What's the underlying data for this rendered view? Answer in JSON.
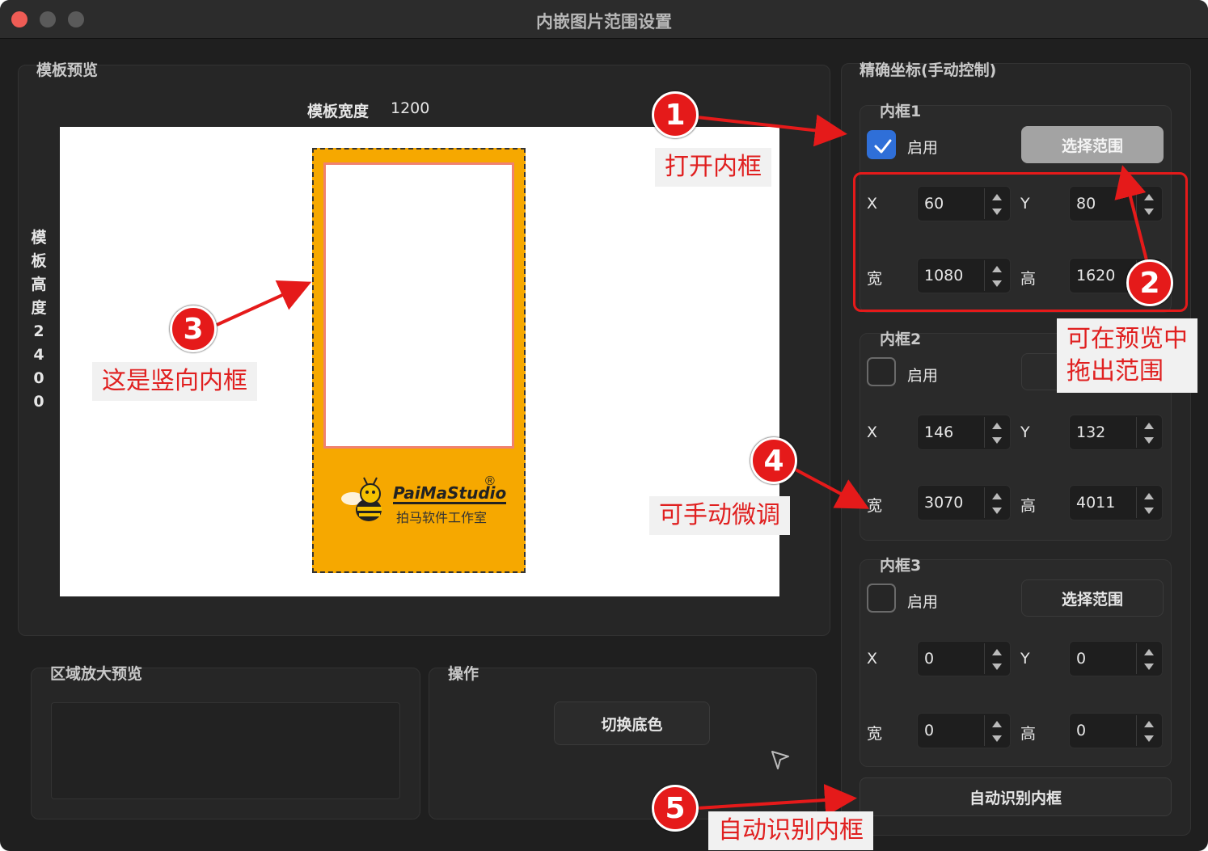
{
  "window": {
    "title": "内嵌图片范围设置"
  },
  "template_preview": {
    "title": "模板预览",
    "width_label": "模板宽度",
    "width_value": "1200",
    "height_label_chars": [
      "模",
      "板",
      "高",
      "度",
      "2",
      "4",
      "0",
      "0"
    ]
  },
  "brand": {
    "name": "PaiMaStudio",
    "registered": "®",
    "subtitle": "拍马软件工作室"
  },
  "zoom_preview": {
    "title": "区域放大预览"
  },
  "operations": {
    "title": "操作",
    "switch_bg_label": "切换底色"
  },
  "precise": {
    "title": "精确坐标(手动控制)",
    "frames": [
      {
        "title": "内框1",
        "enable_label": "启用",
        "enabled": true,
        "select_label": "选择范围",
        "x_label": "X",
        "x": "60",
        "y_label": "Y",
        "y": "80",
        "w_label": "宽",
        "w": "1080",
        "h_label": "高",
        "h": "1620"
      },
      {
        "title": "内框2",
        "enable_label": "启用",
        "enabled": false,
        "x_label": "X",
        "x": "146",
        "y_label": "Y",
        "y": "132",
        "w_label": "宽",
        "w": "3070",
        "h_label": "高",
        "h": "4011"
      },
      {
        "title": "内框3",
        "enable_label": "启用",
        "enabled": false,
        "select_label": "选择范围",
        "x_label": "X",
        "x": "0",
        "y_label": "Y",
        "y": "0",
        "w_label": "宽",
        "w": "0",
        "h_label": "高",
        "h": "0"
      }
    ],
    "auto_detect_label": "自动识别内框"
  },
  "annotations": {
    "badges": [
      "1",
      "2",
      "3",
      "4",
      "5"
    ],
    "open_frame": "打开内框",
    "drag_range_line1": "可在预览中",
    "drag_range_line2": "拖出范围",
    "vertical_frame": "这是竖向内框",
    "manual_adjust": "可手动微调",
    "auto_detect": "自动识别内框"
  },
  "colors": {
    "accent": "#2f6fd8",
    "annotation_red": "#e51a1a",
    "template_orange": "#f6a800"
  }
}
